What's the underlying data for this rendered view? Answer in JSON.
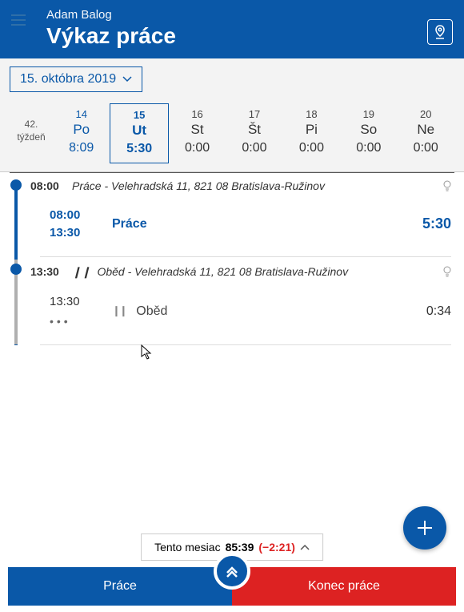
{
  "header": {
    "user": "Adam Balog",
    "title": "Výkaz práce"
  },
  "date_picker": {
    "label": "15. októbra 2019"
  },
  "week": {
    "label_line1": "42.",
    "label_line2": "týždeň",
    "days": [
      {
        "num": "14",
        "name": "Po",
        "time": "8:09",
        "state": "filled"
      },
      {
        "num": "15",
        "name": "Ut",
        "time": "5:30",
        "state": "selected"
      },
      {
        "num": "16",
        "name": "St",
        "time": "0:00",
        "state": ""
      },
      {
        "num": "17",
        "name": "Št",
        "time": "0:00",
        "state": ""
      },
      {
        "num": "18",
        "name": "Pi",
        "time": "0:00",
        "state": ""
      },
      {
        "num": "19",
        "name": "So",
        "time": "0:00",
        "state": ""
      },
      {
        "num": "20",
        "name": "Ne",
        "time": "0:00",
        "state": ""
      }
    ]
  },
  "timeline": [
    {
      "head_time": "08:00",
      "head_text": "Práce - Velehradská 11, 821 08 Bratislava-Ružinov",
      "entry_start": "08:00",
      "entry_end": "13:30",
      "entry_kind": "Práce",
      "entry_dur": "5:30",
      "paused": false
    },
    {
      "head_time": "13:30",
      "head_text": "Oběd - Velehradská 11, 821 08 Bratislava-Ružinov",
      "entry_start": "13:30",
      "entry_end": "",
      "entry_kind": "Oběd",
      "entry_dur": "0:34",
      "paused": true
    }
  ],
  "summary": {
    "label": "Tento mesiac",
    "hours": "85:39",
    "diff": "(−2:21)"
  },
  "bottom": {
    "work": "Práce",
    "end": "Konec práce"
  },
  "icons": {
    "pause": "❙❙"
  }
}
